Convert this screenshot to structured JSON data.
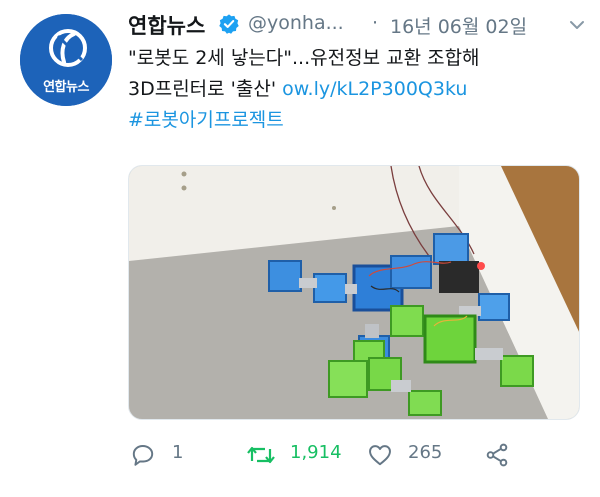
{
  "account": {
    "display_name": "연합뉴스",
    "avatar_label": "연합뉴스",
    "verified": true,
    "handle": "@yonha...",
    "separator": "·",
    "date": "16년 06월 02일"
  },
  "tweet": {
    "line1": "\"로봇도 2세 낳는다\"...유전정보 교환 조합해",
    "line2_text": "3D프린터로 '출산' ",
    "line2_link": "ow.ly/kL2P300Q3ku",
    "hashtag": "#로봇아기프로젝트"
  },
  "actions": {
    "reply_count": "1",
    "retweet_count": "1,914",
    "like_count": "265"
  },
  "colors": {
    "link": "#1b95e0",
    "retweet_active": "#17bf63",
    "verified_badge": "#1da1f2",
    "muted": "#657786",
    "avatar_bg": "#1d63b9"
  },
  "icons": {
    "reply": "speech-bubble-icon",
    "retweet": "retweet-arrows-icon",
    "like": "heart-icon",
    "share": "share-nodes-icon",
    "menu": "chevron-down-icon",
    "verified": "verified-badge-icon"
  }
}
